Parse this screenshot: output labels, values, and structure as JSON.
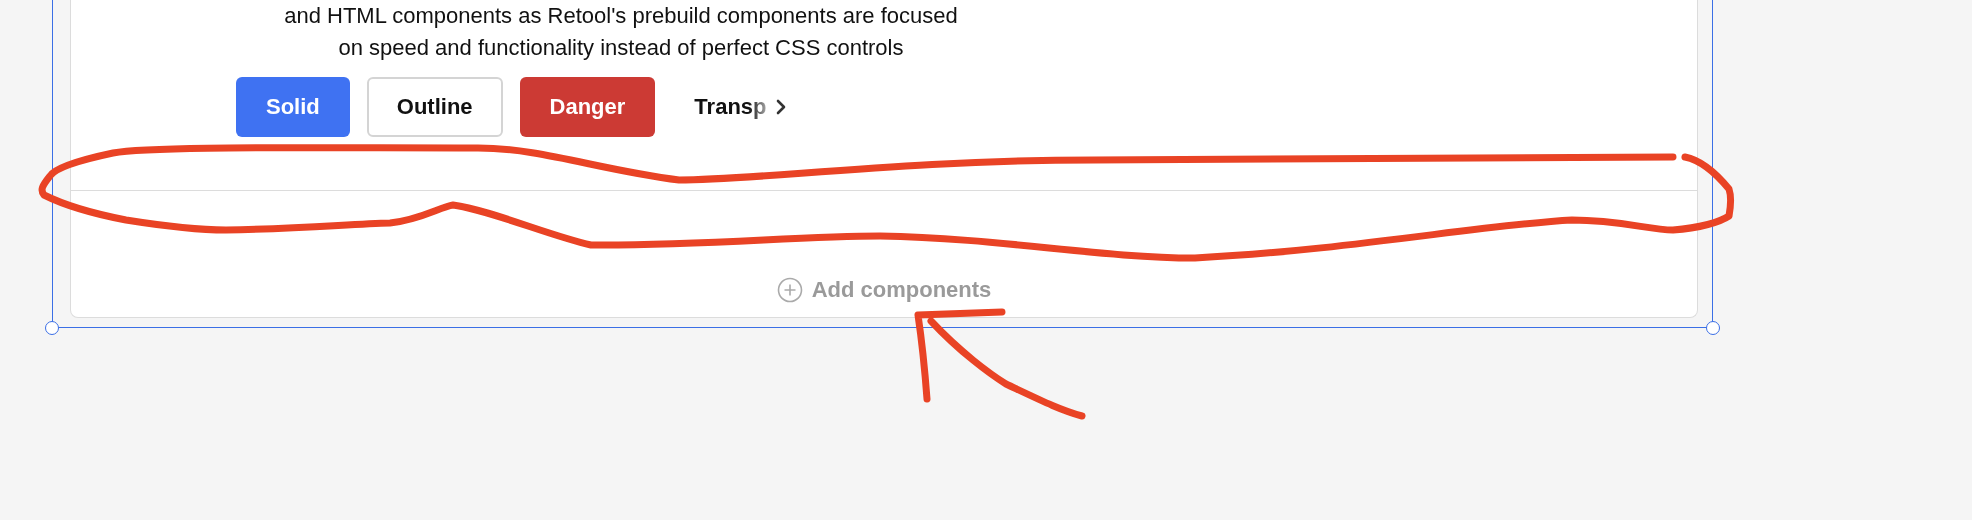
{
  "description": "and HTML components as Retool's prebuild components are focused on speed and functionality instead of perfect CSS controls",
  "buttons": [
    {
      "label": "Solid",
      "kind": "solid"
    },
    {
      "label": "Outline",
      "kind": "outline"
    },
    {
      "label": "Danger",
      "kind": "danger"
    },
    {
      "label": "Transp",
      "kind": "transparent"
    }
  ],
  "add_components": {
    "label": "Add components"
  }
}
